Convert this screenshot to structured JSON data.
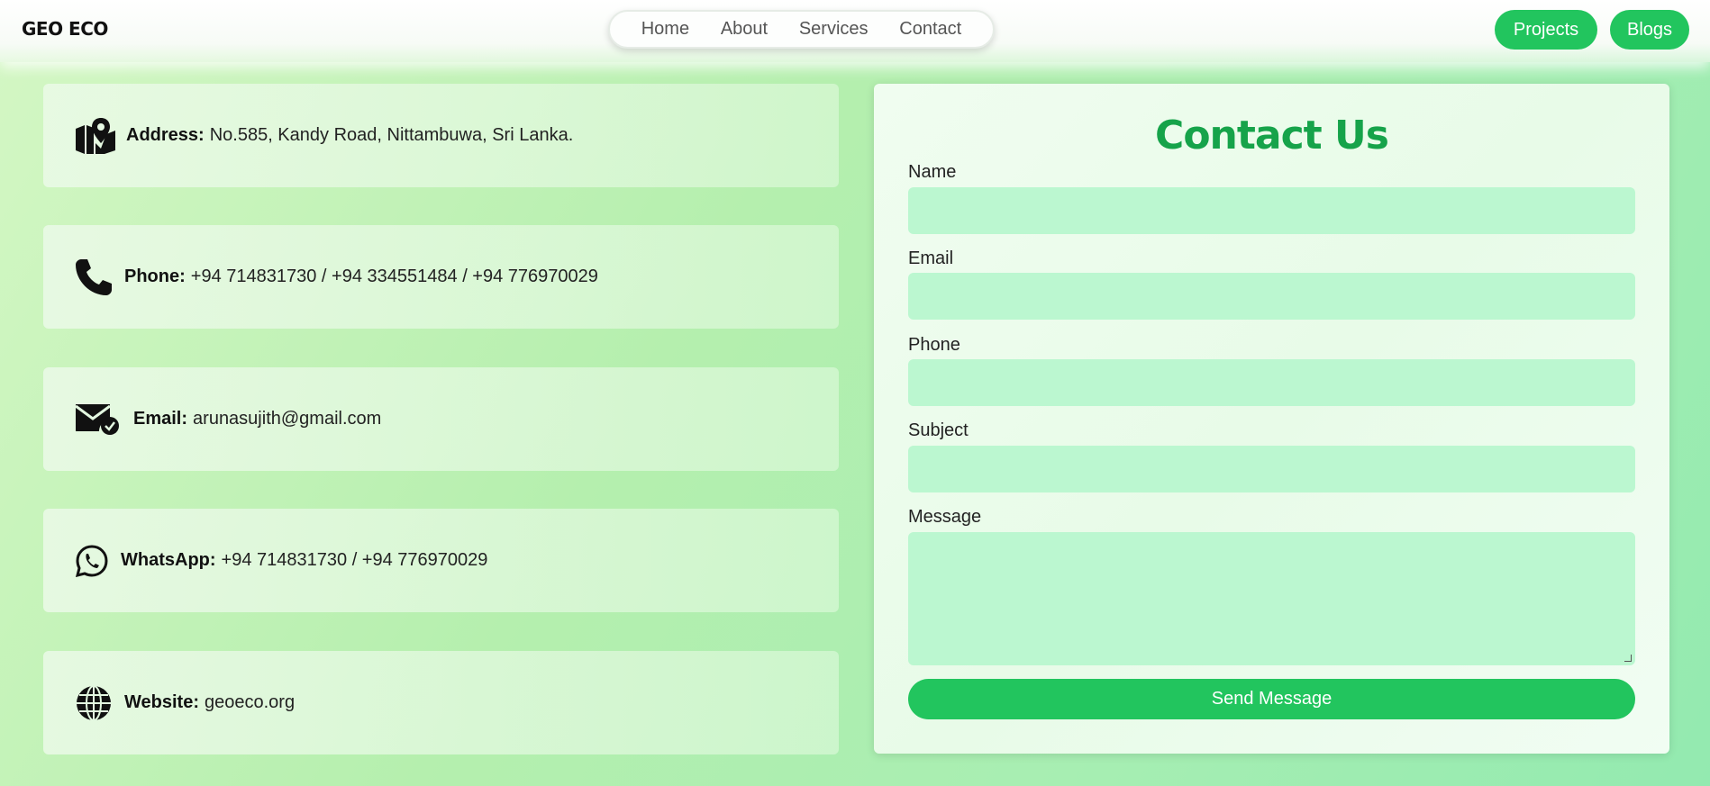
{
  "header": {
    "logo": "GEO ECO",
    "nav": [
      "Home",
      "About",
      "Services",
      "Contact"
    ],
    "projects_label": "Projects",
    "blogs_label": "Blogs"
  },
  "info": [
    {
      "icon": "map-icon",
      "label": "Address:",
      "value": "No.585, Kandy Road, Nittambuwa, Sri Lanka."
    },
    {
      "icon": "phone-icon",
      "label": "Phone:",
      "value": "+94 714831730 / +94 334551484 / +94 776970029"
    },
    {
      "icon": "email-icon",
      "label": "Email:",
      "value": "arunasujith@gmail.com"
    },
    {
      "icon": "whatsapp-icon",
      "label": "WhatsApp:",
      "value": "+94 714831730 / +94 776970029"
    },
    {
      "icon": "globe-icon",
      "label": "Website:",
      "value": "geoeco.org"
    }
  ],
  "form": {
    "title": "Contact Us",
    "name_label": "Name",
    "email_label": "Email",
    "phone_label": "Phone",
    "subject_label": "Subject",
    "message_label": "Message",
    "submit_label": "Send Message"
  },
  "colors": {
    "accent": "#22c55e",
    "title_green": "#16a34a",
    "field_bg": "#bbf7d0"
  }
}
